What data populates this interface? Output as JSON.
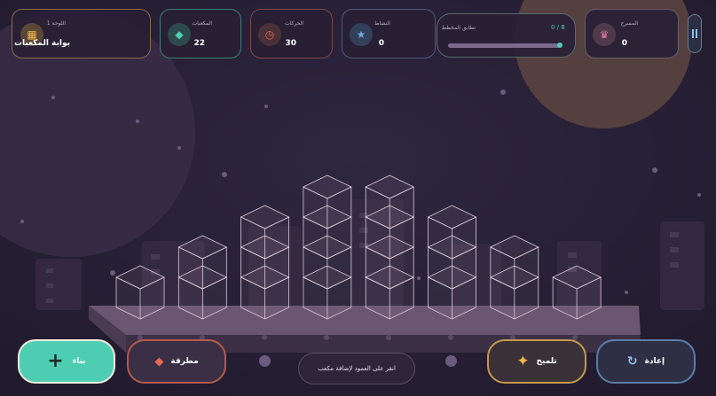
{
  "level": {
    "label": "اللوحة 1",
    "name": "بوابة المكعبات"
  },
  "stats": {
    "cubes": {
      "label": "المكعبات",
      "value": "22"
    },
    "moves": {
      "label": "الحركات",
      "value": "30"
    },
    "score": {
      "label": "النشاط",
      "value": "0"
    },
    "progress": {
      "label": "تطابق المخطط",
      "value": "0 / 8",
      "fraction": 0.0
    },
    "rank": {
      "label": "المسرح",
      "value": "0"
    }
  },
  "buttons": {
    "build": "بناء",
    "hammer": "مطرقة",
    "hint_text": "انقر على العمود لإضافة مكعب",
    "hint": "تلميح",
    "reset": "إعادة"
  },
  "colors": {
    "accent_teal": "#4ecdb3",
    "accent_red": "#e86a52",
    "accent_gold": "#f2b84b",
    "accent_blue": "#6fa8dc",
    "accent_pink": "#e07aa0"
  },
  "icons": {
    "level": "grid-icon",
    "cubes": "diamond-icon",
    "moves": "clock-icon",
    "score": "star-icon",
    "rank": "crown-icon",
    "pause": "pause-icon",
    "build": "plus-icon",
    "hammer": "diamond-icon",
    "hint": "sparkle-icon",
    "reset": "refresh-icon"
  },
  "columns": [
    1,
    2,
    3,
    4,
    4,
    3,
    2,
    1
  ]
}
